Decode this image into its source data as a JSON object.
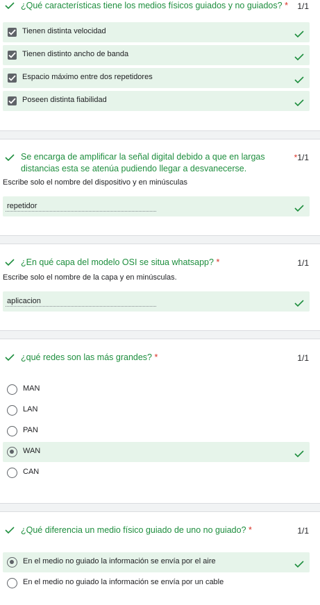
{
  "colors": {
    "correct": "#1e8e3e",
    "correct_bg": "#e6f4ea",
    "required": "#d93025",
    "separator": "#f1f3f4"
  },
  "q1": {
    "title": "¿Qué características tiene los medios físicos guiados y no guiados?",
    "required": "*",
    "score": "1/1",
    "options": [
      "Tienen distinta velocidad",
      "Tienen distinto ancho de banda",
      "Espacio máximo entre dos repetidores",
      "Poseen distinta fiabilidad"
    ]
  },
  "q2": {
    "title_line1": "Se encarga de amplificar la señal digital debido a que en largas",
    "title_line2": "distancias esta se atenúa pudiendo llegar a desvanecerse.",
    "required": "*",
    "score": "1/1",
    "hint": "Escribe solo el nombre del dispositivo y en minúsculas",
    "answer": "repetidor"
  },
  "q3": {
    "title": "¿En qué capa del modelo OSI se situa whatsapp?",
    "required": "*",
    "score": "1/1",
    "hint": "Escribe solo el nombre de la capa y en minúsculas.",
    "answer": "aplicacion"
  },
  "q4": {
    "title": "¿qué redes son las más grandes?",
    "required": "*",
    "score": "1/1",
    "options": [
      "MAN",
      "LAN",
      "PAN",
      "WAN",
      "CAN"
    ],
    "selected": "WAN"
  },
  "q5": {
    "title": "¿Qué diferencia un medio físico guiado de uno no guiado?",
    "required": "*",
    "score": "1/1",
    "options": [
      "En el medio no guiado la información se envía por el aire",
      "En el medio no guiado la información se envía por un cable"
    ],
    "selected": "En el medio no guiado la información se envía por el aire"
  }
}
